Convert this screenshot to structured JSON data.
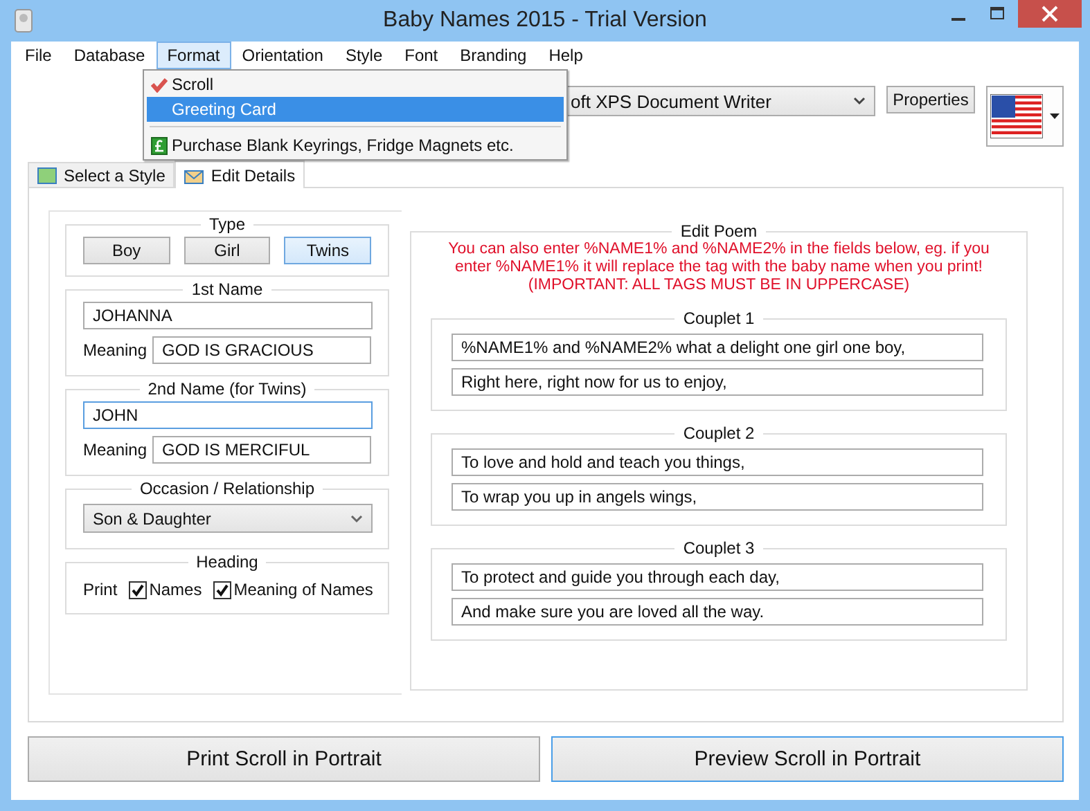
{
  "window": {
    "title": "Baby Names 2015 - Trial Version"
  },
  "menu": [
    {
      "label": "File",
      "selected": false
    },
    {
      "label": "Database",
      "selected": false
    },
    {
      "label": "Format",
      "selected": true
    },
    {
      "label": "Orientation",
      "selected": false
    },
    {
      "label": "Style",
      "selected": false
    },
    {
      "label": "Font",
      "selected": false
    },
    {
      "label": "Branding",
      "selected": false
    },
    {
      "label": "Help",
      "selected": false
    }
  ],
  "format_menu": [
    {
      "kind": "option",
      "label": "Scroll",
      "checked": true,
      "selected": false
    },
    {
      "kind": "option",
      "label": "Greeting Card",
      "checked": false,
      "selected": true
    },
    {
      "kind": "separator"
    },
    {
      "kind": "link",
      "label": "Purchase Blank Keyrings, Fridge Magnets etc.",
      "selected": false
    }
  ],
  "printer": {
    "value": "oft XPS Document Writer"
  },
  "properties_button": "Properties",
  "tabs": [
    {
      "label": "Select a Style",
      "selected": false
    },
    {
      "label": "Edit Details",
      "selected": true
    }
  ],
  "type": {
    "title": "Type",
    "options": [
      {
        "label": "Boy",
        "selected": false
      },
      {
        "label": "Girl",
        "selected": false
      },
      {
        "label": "Twins",
        "selected": true
      }
    ]
  },
  "names": [
    {
      "title": "1st Name",
      "name": "JOHANNA",
      "focused": false,
      "meaning_label": "Meaning",
      "meaning": "GOD IS GRACIOUS"
    },
    {
      "title": "2nd Name (for Twins)",
      "name": "JOHN",
      "focused": true,
      "meaning_label": "Meaning",
      "meaning": "GOD IS MERCIFUL"
    }
  ],
  "occasion": {
    "title": "Occasion / Relationship",
    "value": "Son & Daughter"
  },
  "heading": {
    "title": "Heading",
    "label": "Print",
    "options": [
      {
        "label": "Names",
        "checked": true
      },
      {
        "label": "Meaning of Names",
        "checked": true
      }
    ]
  },
  "poem": {
    "title": "Edit Poem",
    "note": [
      "You can also enter %NAME1% and %NAME2% in the fields below, eg. if you",
      "enter %NAME1% it will replace the tag with the baby name when you print!",
      "(IMPORTANT: ALL TAGS MUST BE IN UPPERCASE)"
    ],
    "couplets": [
      {
        "title": "Couplet 1",
        "lines": [
          "%NAME1% and %NAME2% what a delight one girl one boy,",
          "Right here, right now for us to enjoy,"
        ]
      },
      {
        "title": "Couplet 2",
        "lines": [
          "To love and hold and teach you things,",
          "To wrap you up in angels wings,"
        ]
      },
      {
        "title": "Couplet 3",
        "lines": [
          "To protect and guide you through each day,",
          "And make sure you are loved all the way."
        ]
      }
    ]
  },
  "buttons": [
    {
      "label": "Print Scroll in Portrait",
      "focused": false
    },
    {
      "label": "Preview Scroll in Portrait",
      "focused": true
    }
  ]
}
